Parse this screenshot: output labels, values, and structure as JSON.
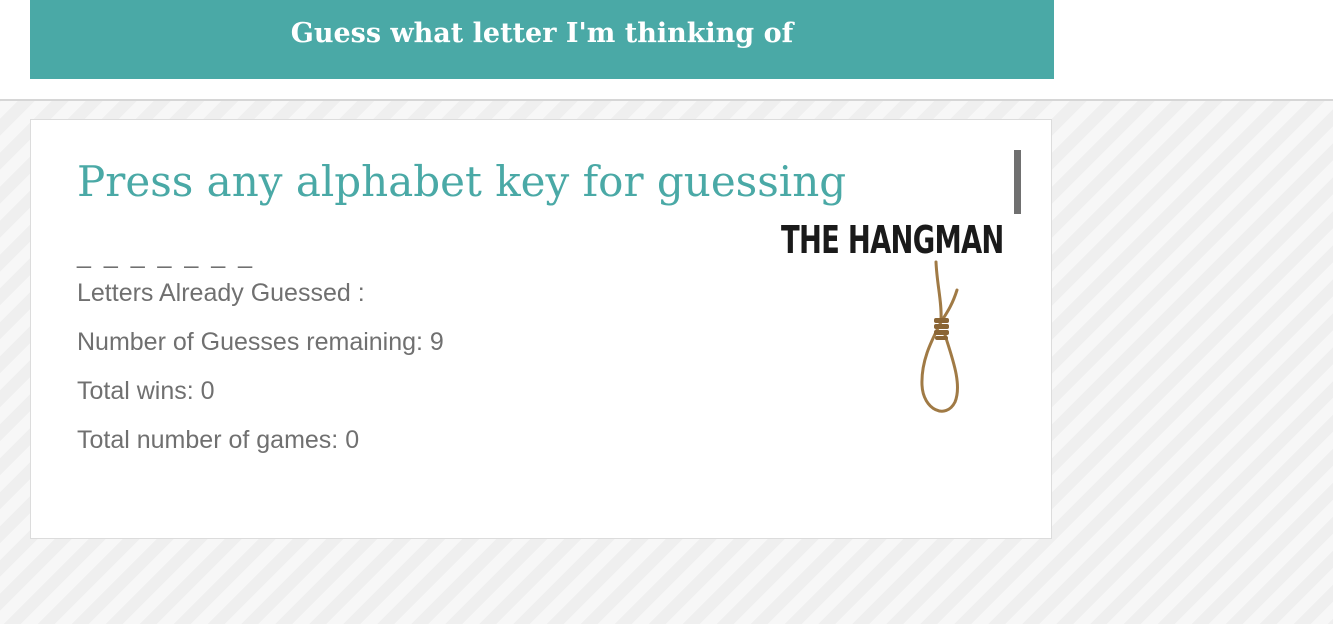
{
  "banner": {
    "title": "Guess what letter I'm thinking of"
  },
  "game": {
    "instruction": "Press any alphabet key for guessing",
    "word_display": "_ _ _ _ _ _ _",
    "letters_guessed": "Letters Already Guessed :",
    "guesses_remaining": "Number of Guesses remaining: 9",
    "total_wins": "Total wins: 0",
    "total_games": "Total number of games: 0"
  },
  "logo": {
    "text": "THE HANGMAN",
    "icon": "noose-icon"
  },
  "colors": {
    "accent": "#4aa9a6",
    "text": "#707070",
    "rope": "#a07a45"
  }
}
